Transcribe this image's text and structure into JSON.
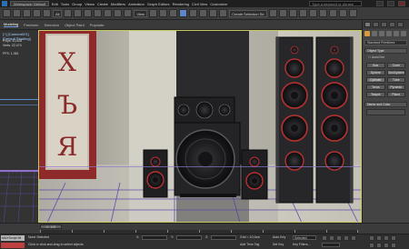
{
  "titlebar": {
    "workspace": "Workspace: Default",
    "menus": [
      "Edit",
      "Tools",
      "Group",
      "Views",
      "Create",
      "Modifiers",
      "Animation",
      "Graph Editors",
      "Rendering",
      "Civil View",
      "Customize"
    ],
    "search_placeholder": "Type a keyword or phrase"
  },
  "toolbar": {
    "filter": "All",
    "view": "View",
    "selection_set": "Create Selection Se"
  },
  "ribbon": {
    "tabs": [
      "Modeling",
      "Freeform",
      "Selection",
      "Object Paint",
      "Populate"
    ]
  },
  "viewport": {
    "label": "[+] [Camera001] [Default Shading]",
    "stats": [
      {
        "label": "Polys:",
        "value": "42,828"
      },
      {
        "label": "Verts:",
        "value": "22,474"
      },
      {
        "label": "FPS:",
        "value": "1.381"
      }
    ],
    "letters": [
      "Х",
      "Ъ",
      "Я"
    ],
    "colors": {
      "panel_red": "#8e2a2a",
      "floor_grid": "#5a3ea8",
      "wall": "#cfcbbf",
      "speaker_body": "#2a2a2c",
      "speaker_ring": "#b83232"
    }
  },
  "command_panel": {
    "selector": "Standard Primitives",
    "rollout_object_type": "Object Type",
    "autogrid": "AutoGrid",
    "buttons": [
      "Box",
      "Cone",
      "Sphere",
      "GeoSphere",
      "Cylinder",
      "Tube",
      "Torus",
      "Pyramid",
      "Teapot",
      "Plane"
    ],
    "rollout_name_color": "Name and Color"
  },
  "timeline": {
    "frame": "0 / 100",
    "ticks": [
      "0",
      "10",
      "20",
      "30",
      "40",
      "50",
      "60",
      "70",
      "80",
      "90",
      "100"
    ]
  },
  "statusbar": {
    "maxscript": "MAXScript Mi",
    "status_line1": "None Selected",
    "status_line2": "Click or click-and-drag to select objects",
    "x_label": "X:",
    "y_label": "Y:",
    "z_label": "Z:",
    "grid": "Grid = 10.0cm",
    "add_time_tag": "Add Time Tag",
    "auto_key": "Auto Key",
    "selected": "Selected",
    "set_key": "Set Key",
    "key_filters": "Key Filters..."
  }
}
